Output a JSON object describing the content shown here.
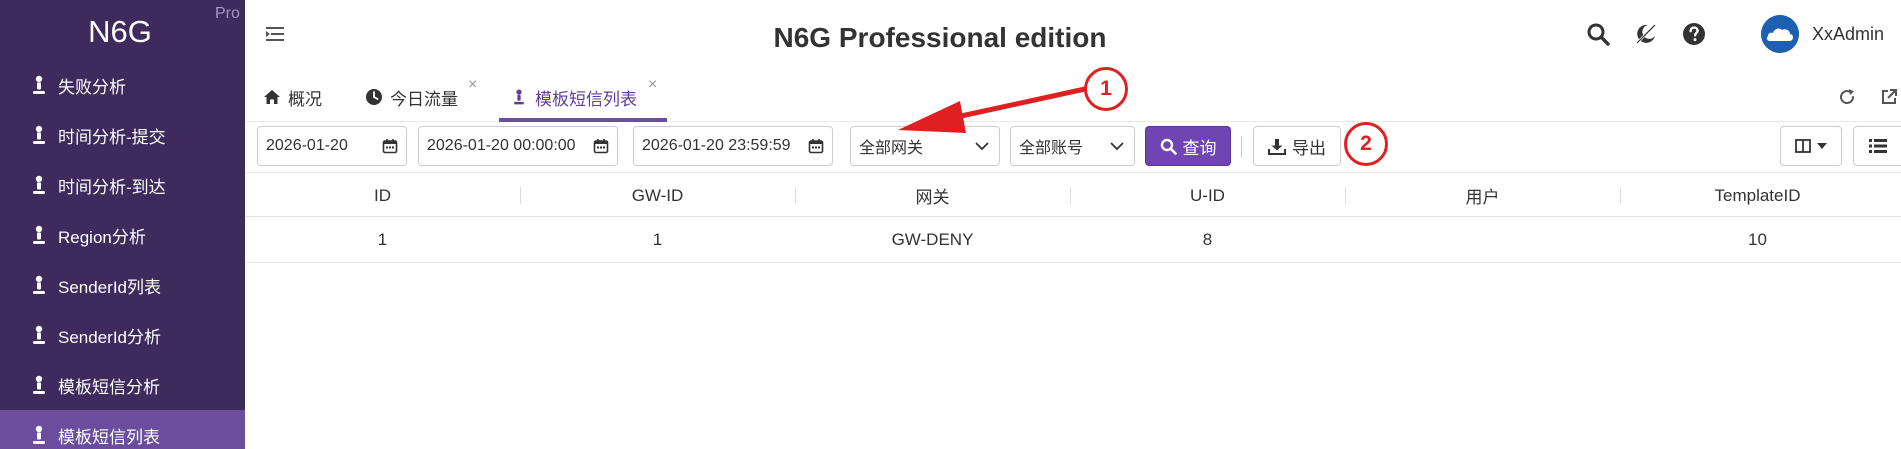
{
  "brand": {
    "name": "N6G",
    "tag": "Pro"
  },
  "sidebar": {
    "items": [
      {
        "label": "失败分析",
        "active": false
      },
      {
        "label": "时间分析-提交",
        "active": false
      },
      {
        "label": "时间分析-到达",
        "active": false
      },
      {
        "label": "Region分析",
        "active": false
      },
      {
        "label": "SenderId列表",
        "active": false
      },
      {
        "label": "SenderId分析",
        "active": false
      },
      {
        "label": "模板短信分析",
        "active": false
      },
      {
        "label": "模板短信列表",
        "active": true
      }
    ]
  },
  "header": {
    "title": "N6G Professional edition",
    "user": "XxAdmin",
    "icons": [
      "search-icon",
      "theme-toggle-icon",
      "help-icon"
    ]
  },
  "tabs": [
    {
      "label": "概况",
      "icon": "home-icon",
      "closable": false,
      "active": false
    },
    {
      "label": "今日流量",
      "icon": "clock-icon",
      "closable": true,
      "active": false
    },
    {
      "label": "模板短信列表",
      "icon": "person-icon",
      "closable": true,
      "active": true
    }
  ],
  "tab_close_glyph": "×",
  "toolbar": {
    "date": "2026-01-20",
    "start_time": "2026-01-20 00:00:00",
    "end_time": "2026-01-20 23:59:59",
    "gateway_select": "全部网关",
    "account_select": "全部账号",
    "query_label": "查询",
    "export_label": "导出"
  },
  "table": {
    "columns": [
      "ID",
      "GW-ID",
      "网关",
      "U-ID",
      "用户",
      "TemplateID"
    ],
    "rows": [
      [
        "1",
        "1",
        "GW-DENY",
        "8",
        "",
        "10"
      ]
    ]
  },
  "annotations": {
    "marker_1": "1",
    "marker_2": "2",
    "color": "#e02020"
  }
}
